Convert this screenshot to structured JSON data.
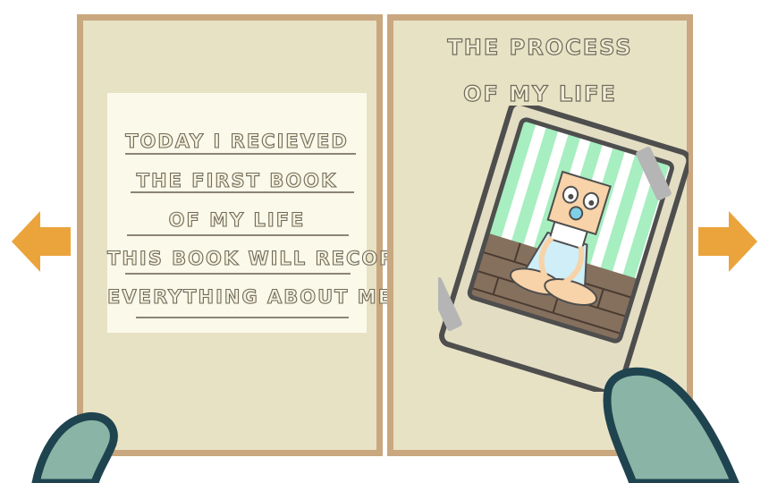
{
  "left_page": {
    "lines": [
      "TODAY I RECIEVED",
      "THE FIRST BOOK",
      "OF MY LIFE",
      "THIS BOOK WILL RECORD",
      "EVERYTHING ABOUT ME"
    ]
  },
  "right_page": {
    "title_lines": [
      "THE PROCESS",
      "OF MY LIFE"
    ]
  },
  "colors": {
    "arrow": "#eba43b",
    "page": "#e8e2c4",
    "page_border": "#c9a77f",
    "hand_fill": "#8ab5a6",
    "hand_outline": "#1f4450",
    "photo_stripes": "#a7eec0"
  },
  "icons": {
    "prev": "left-arrow-icon",
    "next": "right-arrow-icon"
  }
}
